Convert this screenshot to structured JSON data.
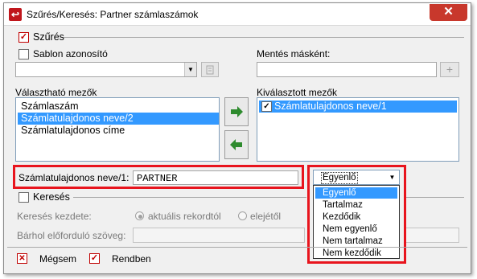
{
  "window": {
    "title": "Szűrés/Keresés: Partner számlaszámok",
    "close_glyph": "✕",
    "app_icon_glyph": "↩"
  },
  "filter": {
    "section_label": "Szűrés",
    "checked": true,
    "template_label": "Sablon azonosító",
    "template_checked": false,
    "template_value": "",
    "save_as_label": "Mentés másként:",
    "save_as_value": "",
    "add_glyph": "+",
    "available_label": "Választható mezők",
    "available_fields": [
      "Számlaszám",
      "Számlatulajdonos neve/2",
      "Számlatulajdonos címe"
    ],
    "available_selected_index": 1,
    "selected_label": "Kiválasztott mezők",
    "selected_fields": [
      {
        "label": "Számlatulajdonos neve/1",
        "checked": true
      }
    ],
    "add_arrow": "➜",
    "remove_arrow": "⬅",
    "condition_field_label": "Számlatulajdonos neve/1:",
    "condition_value": "PARTNER",
    "operator_value": "Egyenlő",
    "operator_options": [
      "Egyenlő",
      "Tartalmaz",
      "Kezdődik",
      "Nem egyenlő",
      "Nem tartalmaz",
      "Nem kezdődik"
    ],
    "operator_selected_index": 0
  },
  "search": {
    "section_label": "Keresés",
    "checked": false,
    "start_label": "Keresés kezdete:",
    "radio_current": "aktuális rekordtól",
    "radio_start": "elejétől",
    "anywhere_label": "Bárhol előforduló szöveg:",
    "anywhere_value": ""
  },
  "footer": {
    "cancel_label": "Mégsem",
    "ok_label": "Rendben",
    "cancel_glyph": "✕",
    "ok_glyph": "✓"
  },
  "colors": {
    "highlight": "#e8141d",
    "selection": "#3399ff",
    "arrow_green": "#2e8b2e"
  }
}
